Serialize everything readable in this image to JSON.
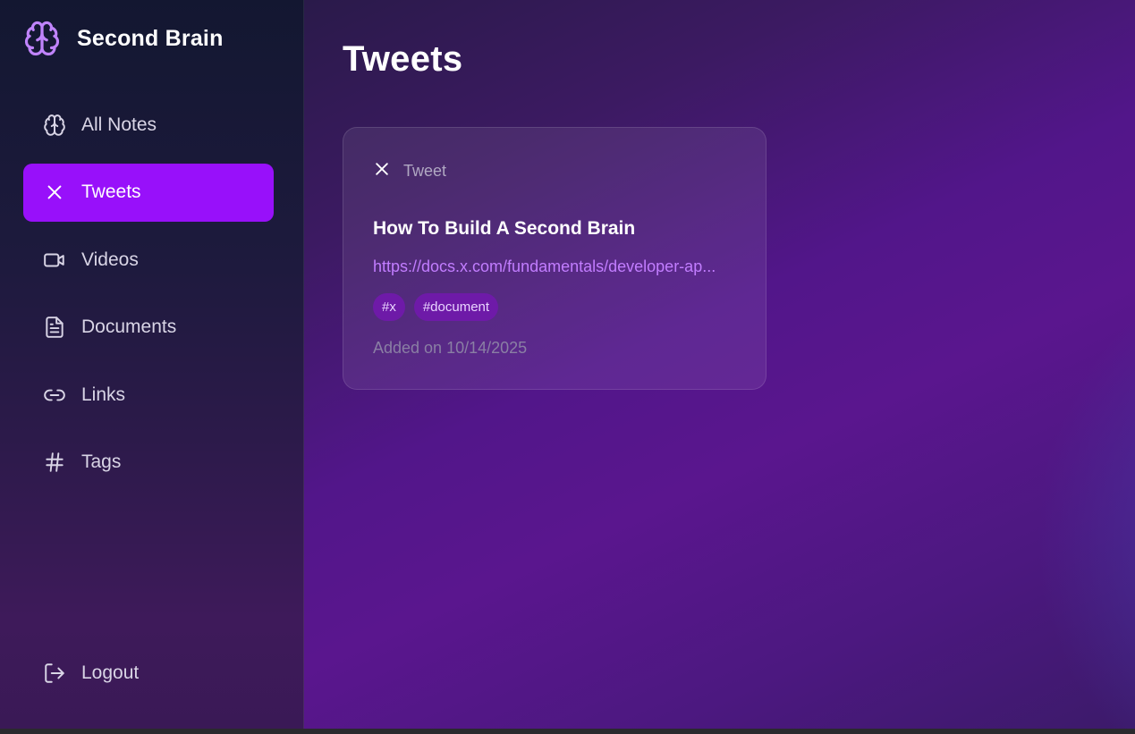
{
  "brand": {
    "title": "Second Brain",
    "icon": "brain-icon",
    "accent": "#c084fc"
  },
  "sidebar": {
    "items": [
      {
        "label": "All Notes",
        "icon": "brain-icon",
        "active": false
      },
      {
        "label": "Tweets",
        "icon": "x-icon",
        "active": true
      },
      {
        "label": "Videos",
        "icon": "video-icon",
        "active": false
      },
      {
        "label": "Documents",
        "icon": "document-icon",
        "active": false
      },
      {
        "label": "Links",
        "icon": "link-icon",
        "active": false
      },
      {
        "label": "Tags",
        "icon": "hash-icon",
        "active": false
      }
    ],
    "logout": {
      "label": "Logout",
      "icon": "logout-icon"
    },
    "active_color": "#9810fa"
  },
  "main": {
    "title": "Tweets",
    "cards": [
      {
        "type_label": "Tweet",
        "type_icon": "x-icon",
        "title": "How To Build A Second Brain",
        "link": "https://docs.x.com/fundamentals/developer-ap...",
        "tags": [
          "#x",
          "#document"
        ],
        "date": "Added on 10/14/2025"
      }
    ]
  }
}
